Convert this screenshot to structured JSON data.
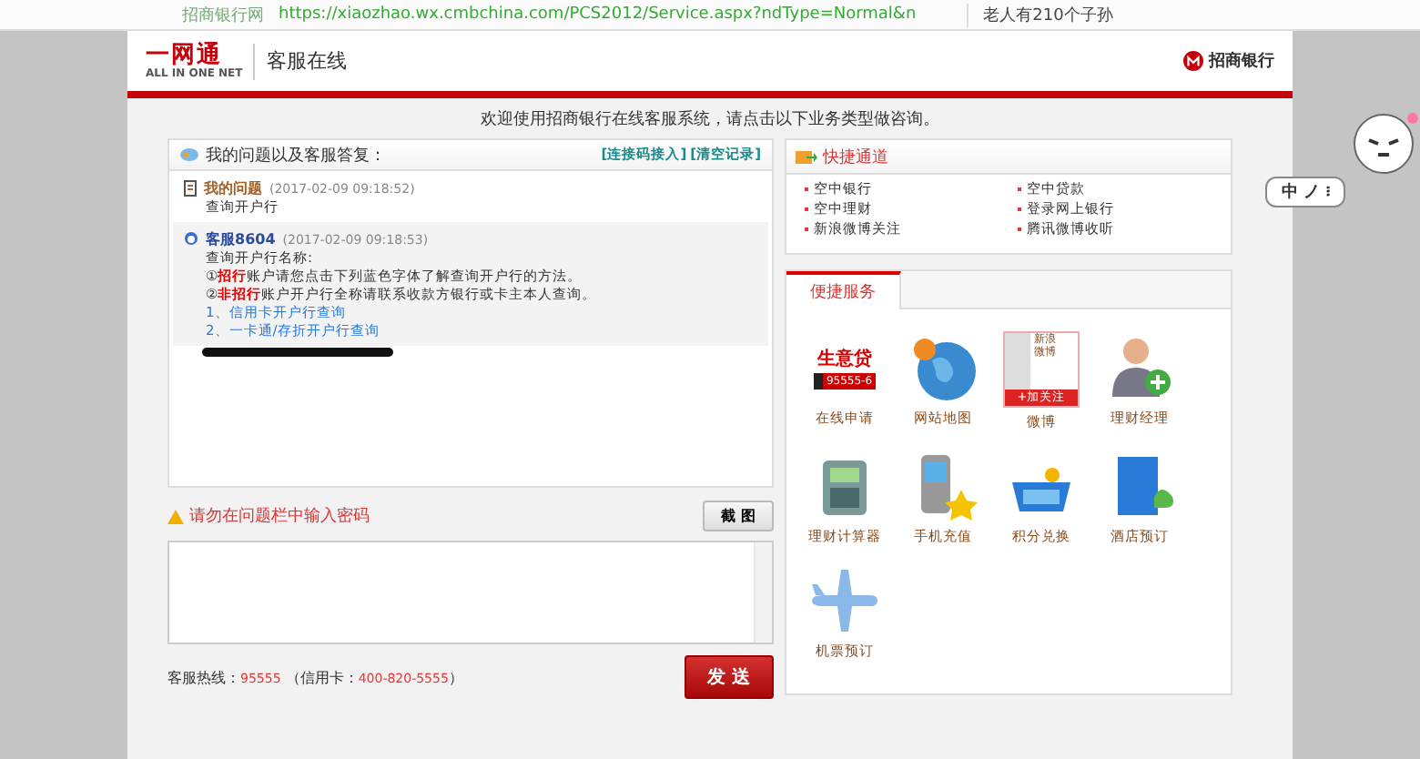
{
  "browser": {
    "tab_title": "招商银行网",
    "url": "https://xiaozhao.wx.cmbchina.com/PCS2012/Service.aspx?ndType=Normal&n",
    "search": "老人有210个子孙"
  },
  "header": {
    "logo": "一网通",
    "logo_sub": "ALL IN ONE NET",
    "service_title": "客服在线",
    "bank_name": "招商银行"
  },
  "welcome": "欢迎使用招商银行在线客服系统，请点击以下业务类型做咨询。",
  "chat": {
    "title": "我的问题以及客服答复：",
    "actions": [
      "[连接码接入]",
      "[清空记录]"
    ],
    "messages": [
      {
        "kind": "user",
        "sender": "我的问题",
        "time": "(2017-02-09 09:18:52)",
        "lines": [
          "查询开户行"
        ]
      },
      {
        "kind": "agent",
        "sender": "客服8604",
        "time": "(2017-02-09 09:18:53)",
        "lines": [
          "查询开户行名称:",
          "①**招行**账户请您点击下列蓝色字体了解查询开户行的方法。",
          "②**非招行**账户开户行全称请联系收款方银行或卡主本人查询。"
        ],
        "links": [
          "1、信用卡开户行查询",
          "2、一卡通/存折开户行查询"
        ]
      }
    ]
  },
  "warning": "请勿在问题栏中输入密码",
  "screenshot_button": "截 图",
  "hotline": {
    "label": "客服热线：",
    "number": "95555",
    "card_label": "（信用卡：",
    "card_number": "400-820-5555",
    "close": "）"
  },
  "send_button": "发 送",
  "quick": {
    "title": "快捷通道",
    "links": [
      "空中银行",
      "空中贷款",
      "空中理财",
      "登录网上银行",
      "新浪微博关注",
      "腾讯微博收听"
    ]
  },
  "services": {
    "tab": "便捷服务",
    "items": [
      {
        "kind": "loan",
        "label": "在线申请"
      },
      {
        "kind": "globe",
        "label": "网站地图"
      },
      {
        "kind": "weibo",
        "label": "微博"
      },
      {
        "kind": "person",
        "label": "理财经理"
      },
      {
        "kind": "calculator",
        "label": "理财计算器"
      },
      {
        "kind": "phone",
        "label": "手机充值"
      },
      {
        "kind": "basket",
        "label": "积分兑换"
      },
      {
        "kind": "hotel",
        "label": "酒店预订"
      },
      {
        "kind": "plane",
        "label": "机票预订"
      }
    ],
    "loan_badge": [
      "生意贷",
      "95555-6"
    ],
    "weibo_badge": [
      "新浪",
      "微博",
      "+加关注"
    ]
  },
  "ime": {
    "mode": "中",
    "marks": "ノ ፧"
  }
}
